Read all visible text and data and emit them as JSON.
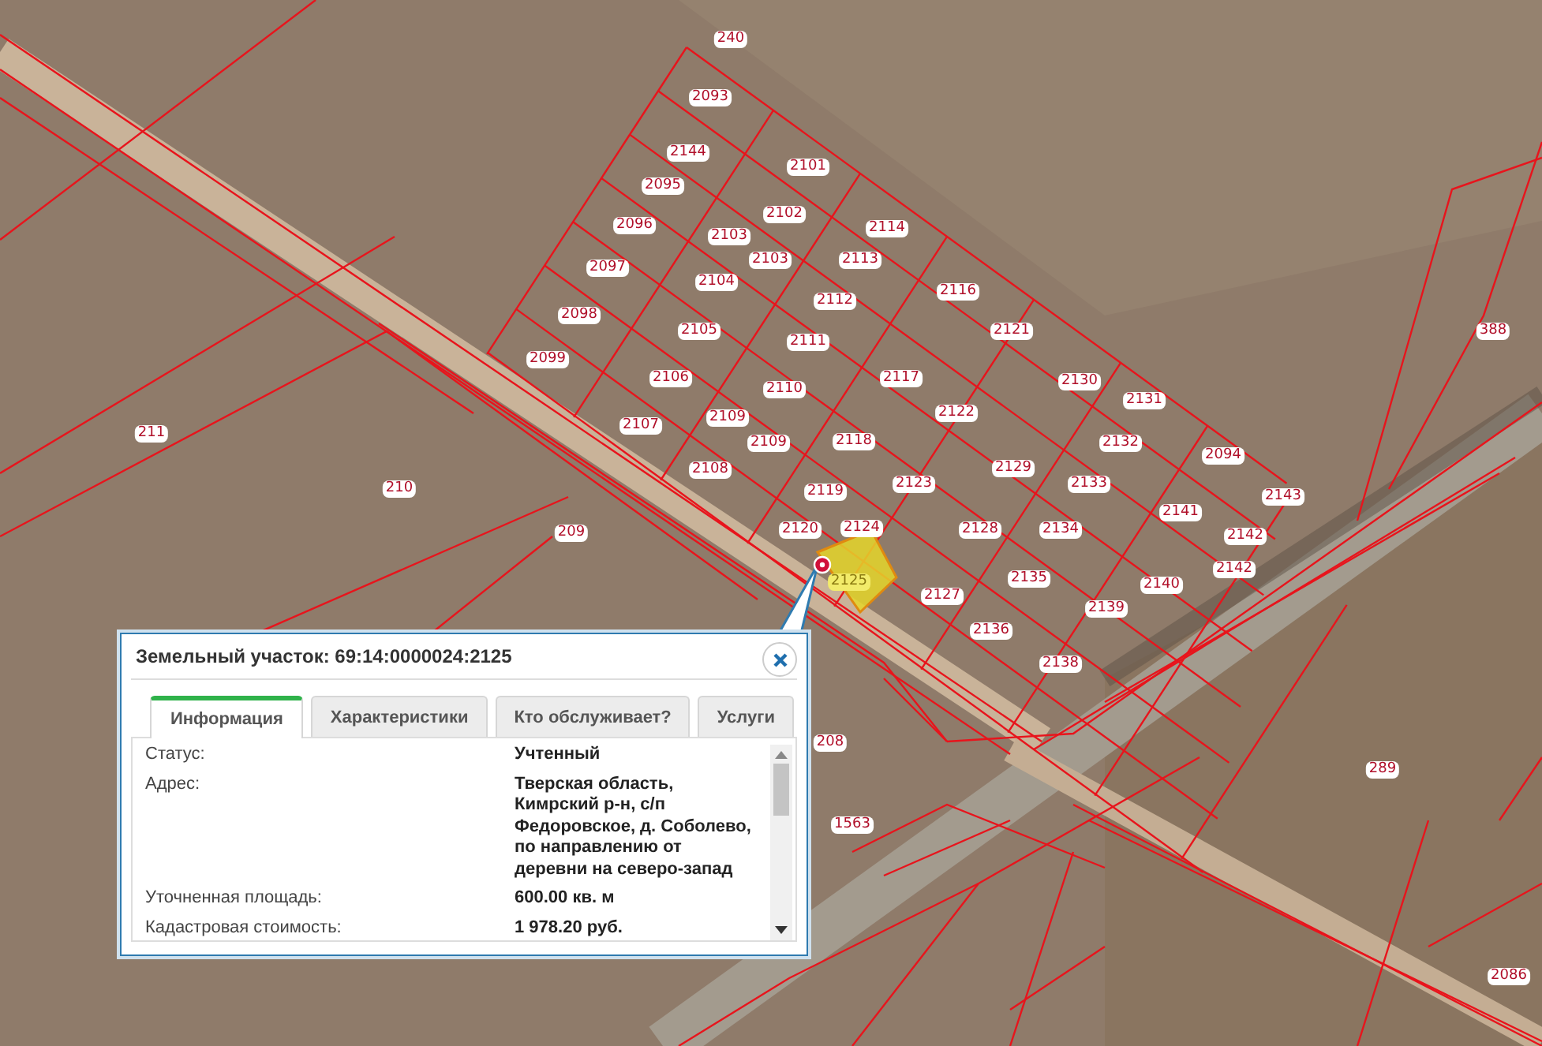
{
  "map": {
    "parcel_labels": [
      {
        "text": "240",
        "selected": false
      },
      {
        "text": "2093",
        "selected": false
      },
      {
        "text": "2144",
        "selected": false
      },
      {
        "text": "2101",
        "selected": false
      },
      {
        "text": "2095",
        "selected": false
      },
      {
        "text": "2114",
        "selected": false
      },
      {
        "text": "2102",
        "selected": false
      },
      {
        "text": "2096",
        "selected": false
      },
      {
        "text": "2103",
        "selected": false
      },
      {
        "text": "2103",
        "selected": false
      },
      {
        "text": "2113",
        "selected": false
      },
      {
        "text": "2097",
        "selected": false
      },
      {
        "text": "2104",
        "selected": false
      },
      {
        "text": "2116",
        "selected": false
      },
      {
        "text": "2112",
        "selected": false
      },
      {
        "text": "2098",
        "selected": false
      },
      {
        "text": "2105",
        "selected": false
      },
      {
        "text": "2111",
        "selected": false
      },
      {
        "text": "2121",
        "selected": false
      },
      {
        "text": "2099",
        "selected": false
      },
      {
        "text": "2106",
        "selected": false
      },
      {
        "text": "2110",
        "selected": false
      },
      {
        "text": "2117",
        "selected": false
      },
      {
        "text": "2130",
        "selected": false
      },
      {
        "text": "2131",
        "selected": false
      },
      {
        "text": "2107",
        "selected": false
      },
      {
        "text": "2109",
        "selected": false
      },
      {
        "text": "2109",
        "selected": false
      },
      {
        "text": "2122",
        "selected": false
      },
      {
        "text": "2118",
        "selected": false
      },
      {
        "text": "2132",
        "selected": false
      },
      {
        "text": "2094",
        "selected": false
      },
      {
        "text": "2108",
        "selected": false
      },
      {
        "text": "2119",
        "selected": false
      },
      {
        "text": "2123",
        "selected": false
      },
      {
        "text": "2129",
        "selected": false
      },
      {
        "text": "2133",
        "selected": false
      },
      {
        "text": "2143",
        "selected": false
      },
      {
        "text": "2141",
        "selected": false
      },
      {
        "text": "2120",
        "selected": false
      },
      {
        "text": "2124",
        "selected": false
      },
      {
        "text": "2128",
        "selected": false
      },
      {
        "text": "2134",
        "selected": false
      },
      {
        "text": "2142",
        "selected": false
      },
      {
        "text": "2142",
        "selected": false
      },
      {
        "text": "2125",
        "selected": true
      },
      {
        "text": "2135",
        "selected": false
      },
      {
        "text": "2127",
        "selected": false
      },
      {
        "text": "2140",
        "selected": false
      },
      {
        "text": "2139",
        "selected": false
      },
      {
        "text": "2136",
        "selected": false
      },
      {
        "text": "2138",
        "selected": false
      },
      {
        "text": "388",
        "selected": false
      },
      {
        "text": "211",
        "selected": false
      },
      {
        "text": "210",
        "selected": false
      },
      {
        "text": "209",
        "selected": false
      },
      {
        "text": "208",
        "selected": false
      },
      {
        "text": "1563",
        "selected": false
      },
      {
        "text": "289",
        "selected": false
      },
      {
        "text": "2086",
        "selected": false
      }
    ]
  },
  "popup": {
    "title": "Земельный участок: 69:14:0000024:2125",
    "tabs": [
      {
        "label": "Информация",
        "selected": true
      },
      {
        "label": "Характеристики",
        "selected": false
      },
      {
        "label": "Кто обслуживает?",
        "selected": false
      },
      {
        "label": "Услуги",
        "selected": false
      }
    ],
    "rows": [
      {
        "label": "Статус:",
        "value": "Учтенный"
      },
      {
        "label": "Адрес:",
        "value": "Тверская область, Кимрский р-н, с/п Федоровское, д. Соболево, по направлению от деревни на северо-запад"
      },
      {
        "label": "Уточненная площадь:",
        "value": "600.00 кв. м"
      },
      {
        "label": "Кадастровая стоимость:",
        "value": "1 978.20 руб."
      }
    ]
  }
}
